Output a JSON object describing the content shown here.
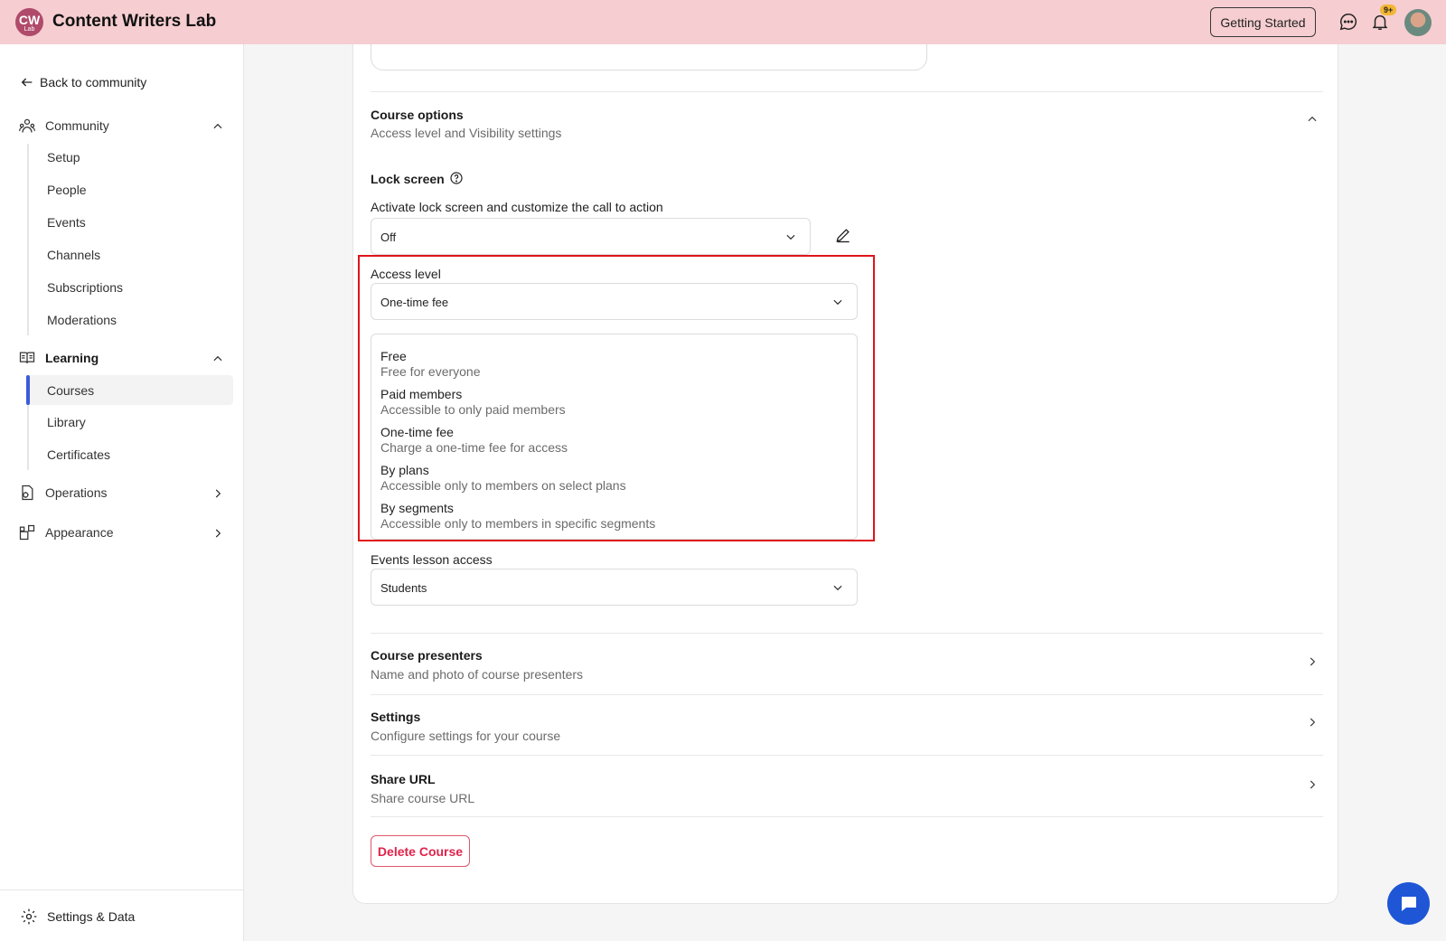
{
  "header": {
    "logo_text": "CW",
    "logo_sub": "Lab",
    "app_title": "Content Writers Lab",
    "getting_started": "Getting Started",
    "notification_badge": "9+"
  },
  "sidebar": {
    "back_label": "Back to community",
    "community": {
      "label": "Community",
      "items": [
        "Setup",
        "People",
        "Events",
        "Channels",
        "Subscriptions",
        "Moderations"
      ]
    },
    "learning": {
      "label": "Learning",
      "items": [
        "Courses",
        "Library",
        "Certificates"
      ],
      "active": "Courses"
    },
    "operations_label": "Operations",
    "appearance_label": "Appearance",
    "footer_label": "Settings & Data"
  },
  "main": {
    "course_options": {
      "title": "Course options",
      "subtitle": "Access level and Visibility settings"
    },
    "lock_screen": {
      "label": "Lock screen",
      "description": "Activate lock screen and customize the call to action",
      "value": "Off"
    },
    "access_level": {
      "label": "Access level",
      "value": "One-time fee",
      "options": [
        {
          "title": "Free",
          "desc": "Free for everyone"
        },
        {
          "title": "Paid members",
          "desc": "Accessible to only paid members"
        },
        {
          "title": "One-time fee",
          "desc": "Charge a one-time fee for access"
        },
        {
          "title": "By plans",
          "desc": "Accessible only to members on select plans"
        },
        {
          "title": "By segments",
          "desc": "Accessible only to members in specific segments"
        }
      ]
    },
    "events_lesson_access": {
      "label": "Events lesson access",
      "value": "Students"
    },
    "sections": [
      {
        "title": "Course presenters",
        "subtitle": "Name and photo of course presenters"
      },
      {
        "title": "Settings",
        "subtitle": "Configure settings for your course"
      },
      {
        "title": "Share URL",
        "subtitle": "Share course URL"
      }
    ],
    "delete_label": "Delete Course"
  },
  "colors": {
    "topbar": "#f6cdd0",
    "accent": "#3b5bdb",
    "danger": "#e0234a",
    "highlight": "#e0141c"
  }
}
